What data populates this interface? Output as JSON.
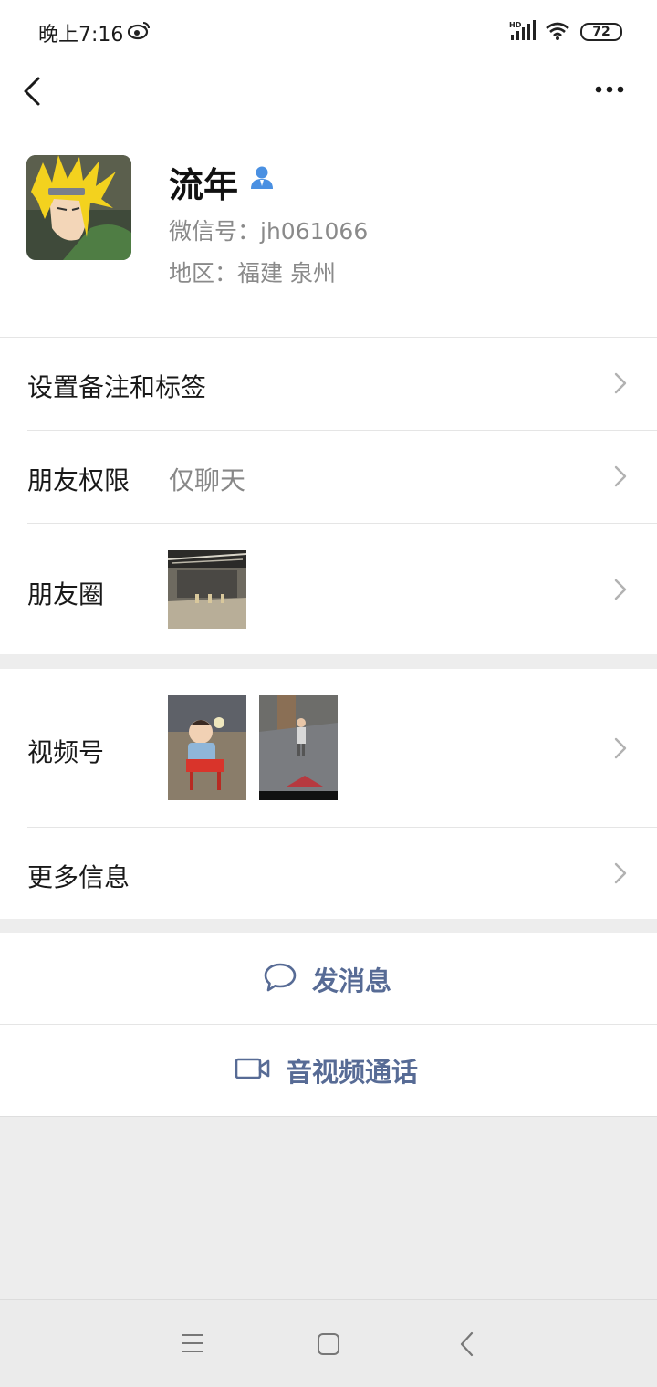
{
  "status_bar": {
    "time": "晚上7:16",
    "battery": "72",
    "icons": [
      "weibo-icon",
      "hd-signal-icon",
      "wifi-icon",
      "battery-icon"
    ]
  },
  "top_nav": {
    "back_icon": "back-arrow-icon",
    "more_icon": "more-dots-icon"
  },
  "profile": {
    "name": "流年",
    "wechat_id": "微信号：jh061066",
    "region": "地区：福建  泉州",
    "badge_icon": "person-icon"
  },
  "menu": {
    "remark": {
      "label": "设置备注和标签"
    },
    "permission": {
      "label": "朋友权限",
      "value": "仅聊天"
    },
    "moments": {
      "label": "朋友圈"
    },
    "channels": {
      "label": "视频号"
    },
    "more_info": {
      "label": "更多信息"
    }
  },
  "actions": {
    "message": {
      "label": "发消息",
      "icon": "chat-bubble-icon"
    },
    "call": {
      "label": "音视频通话",
      "icon": "video-camera-icon"
    }
  },
  "colors": {
    "link": "#576b95",
    "badge": "#4a90e2",
    "background": "#ededed"
  }
}
